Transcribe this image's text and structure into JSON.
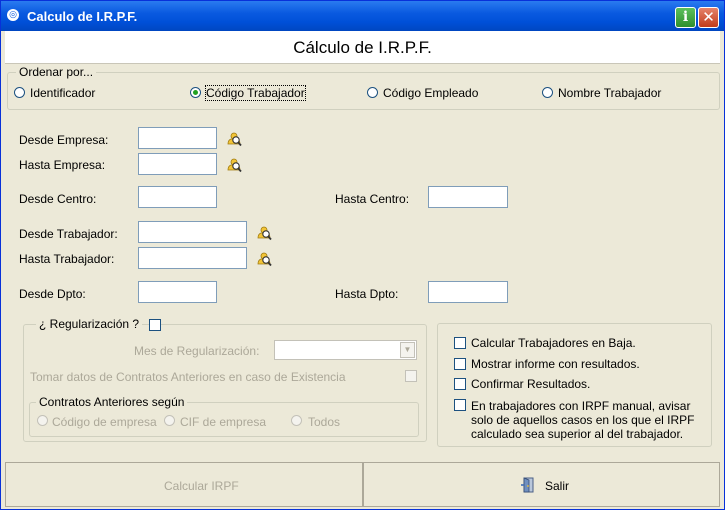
{
  "window": {
    "title": "Calculo de I.R.P.F.",
    "info_button": "i",
    "close_button": "✕"
  },
  "header": {
    "title": "Cálculo de I.R.P.F."
  },
  "order": {
    "legend": "Ordenar por...",
    "options": [
      {
        "label": "Identificador",
        "checked": false
      },
      {
        "label": "Código Trabajador",
        "checked": true
      },
      {
        "label": "Código Empleado",
        "checked": false
      },
      {
        "label": "Nombre Trabajador",
        "checked": false
      }
    ]
  },
  "filters": {
    "desde_empresa": {
      "label": "Desde Empresa:",
      "value": ""
    },
    "hasta_empresa": {
      "label": "Hasta Empresa:",
      "value": ""
    },
    "desde_centro": {
      "label": "Desde Centro:",
      "value": ""
    },
    "hasta_centro": {
      "label": "Hasta Centro:",
      "value": ""
    },
    "desde_trabajador": {
      "label": "Desde Trabajador:",
      "value": ""
    },
    "hasta_trabajador": {
      "label": "Hasta Trabajador:",
      "value": ""
    },
    "desde_dpto": {
      "label": "Desde Dpto:",
      "value": ""
    },
    "hasta_dpto": {
      "label": "Hasta Dpto:",
      "value": ""
    }
  },
  "regularizacion": {
    "legend": "¿ Regularización ?",
    "checked": false,
    "mes_label": "Mes de Regularización:",
    "mes_value": "",
    "tomar_datos_label": "Tomar datos de Contratos Anteriores en caso de Existencia",
    "contratos": {
      "legend": "Contratos Anteriores según",
      "options": [
        "Código de empresa",
        "CIF de empresa",
        "Todos"
      ]
    }
  },
  "options": [
    {
      "label": "Calcular Trabajadores en Baja.",
      "checked": false
    },
    {
      "label": "Mostrar informe con resultados.",
      "checked": false
    },
    {
      "label": "Confirmar Resultados.",
      "checked": false
    },
    {
      "label": [
        "En trabajadores con IRPF manual, avisar",
        "solo de aquellos casos en los que el IRPF",
        "calculado sea superior al del trabajador."
      ],
      "checked": false
    }
  ],
  "buttons": {
    "calcular": "Calcular IRPF",
    "salir": "Salir"
  },
  "colors": {
    "titlebar": "#0a5ae0",
    "face": "#ece9d8",
    "radio_dot": "#21a121"
  }
}
